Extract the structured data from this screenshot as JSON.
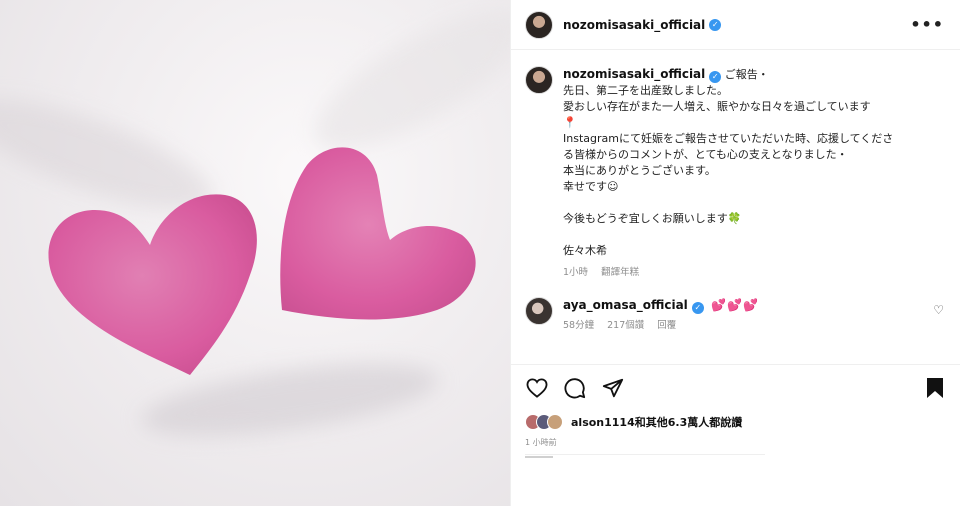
{
  "post": {
    "username": "nozomisasaki_official",
    "verified_icon": "verified-badge-icon",
    "more_icon": "more-horizontal-icon",
    "more_label": "•••"
  },
  "caption": {
    "username": "nozomisasaki_official",
    "lines": [
      "ご報告・",
      "先日、第二子を出産致しました。",
      "愛おしい存在がまた一人増え、賑やかな日々を過ごしています",
      "📍",
      "Instagramにて妊娠をご報告させていただいた時、応援してくださ",
      "る皆様からのコメントが、とても心の支えとなりました・",
      "本当にありがとうございます。",
      "幸せです☺",
      "",
      "今後もどうぞ宜しくお願いします🍀",
      "",
      "佐々木希"
    ],
    "time": "1小時",
    "translate": "翻譯年糕"
  },
  "comment": {
    "username": "aya_omasa_official",
    "hearts": "💕💕💕",
    "time": "58分鐘",
    "likes": "217個讚",
    "reply": "回覆"
  },
  "actions": {
    "like_icon": "heart-icon",
    "comment_icon": "comment-icon",
    "share_icon": "send-icon",
    "save_icon": "bookmark-icon"
  },
  "likes_summary": {
    "text": "alson1114和其他6.3萬人都說讚",
    "time": "1 小時前"
  },
  "colors": {
    "heart_pink": "#d8549b",
    "verified_blue": "#3897f0",
    "meta_gray": "#8e8e8e"
  }
}
